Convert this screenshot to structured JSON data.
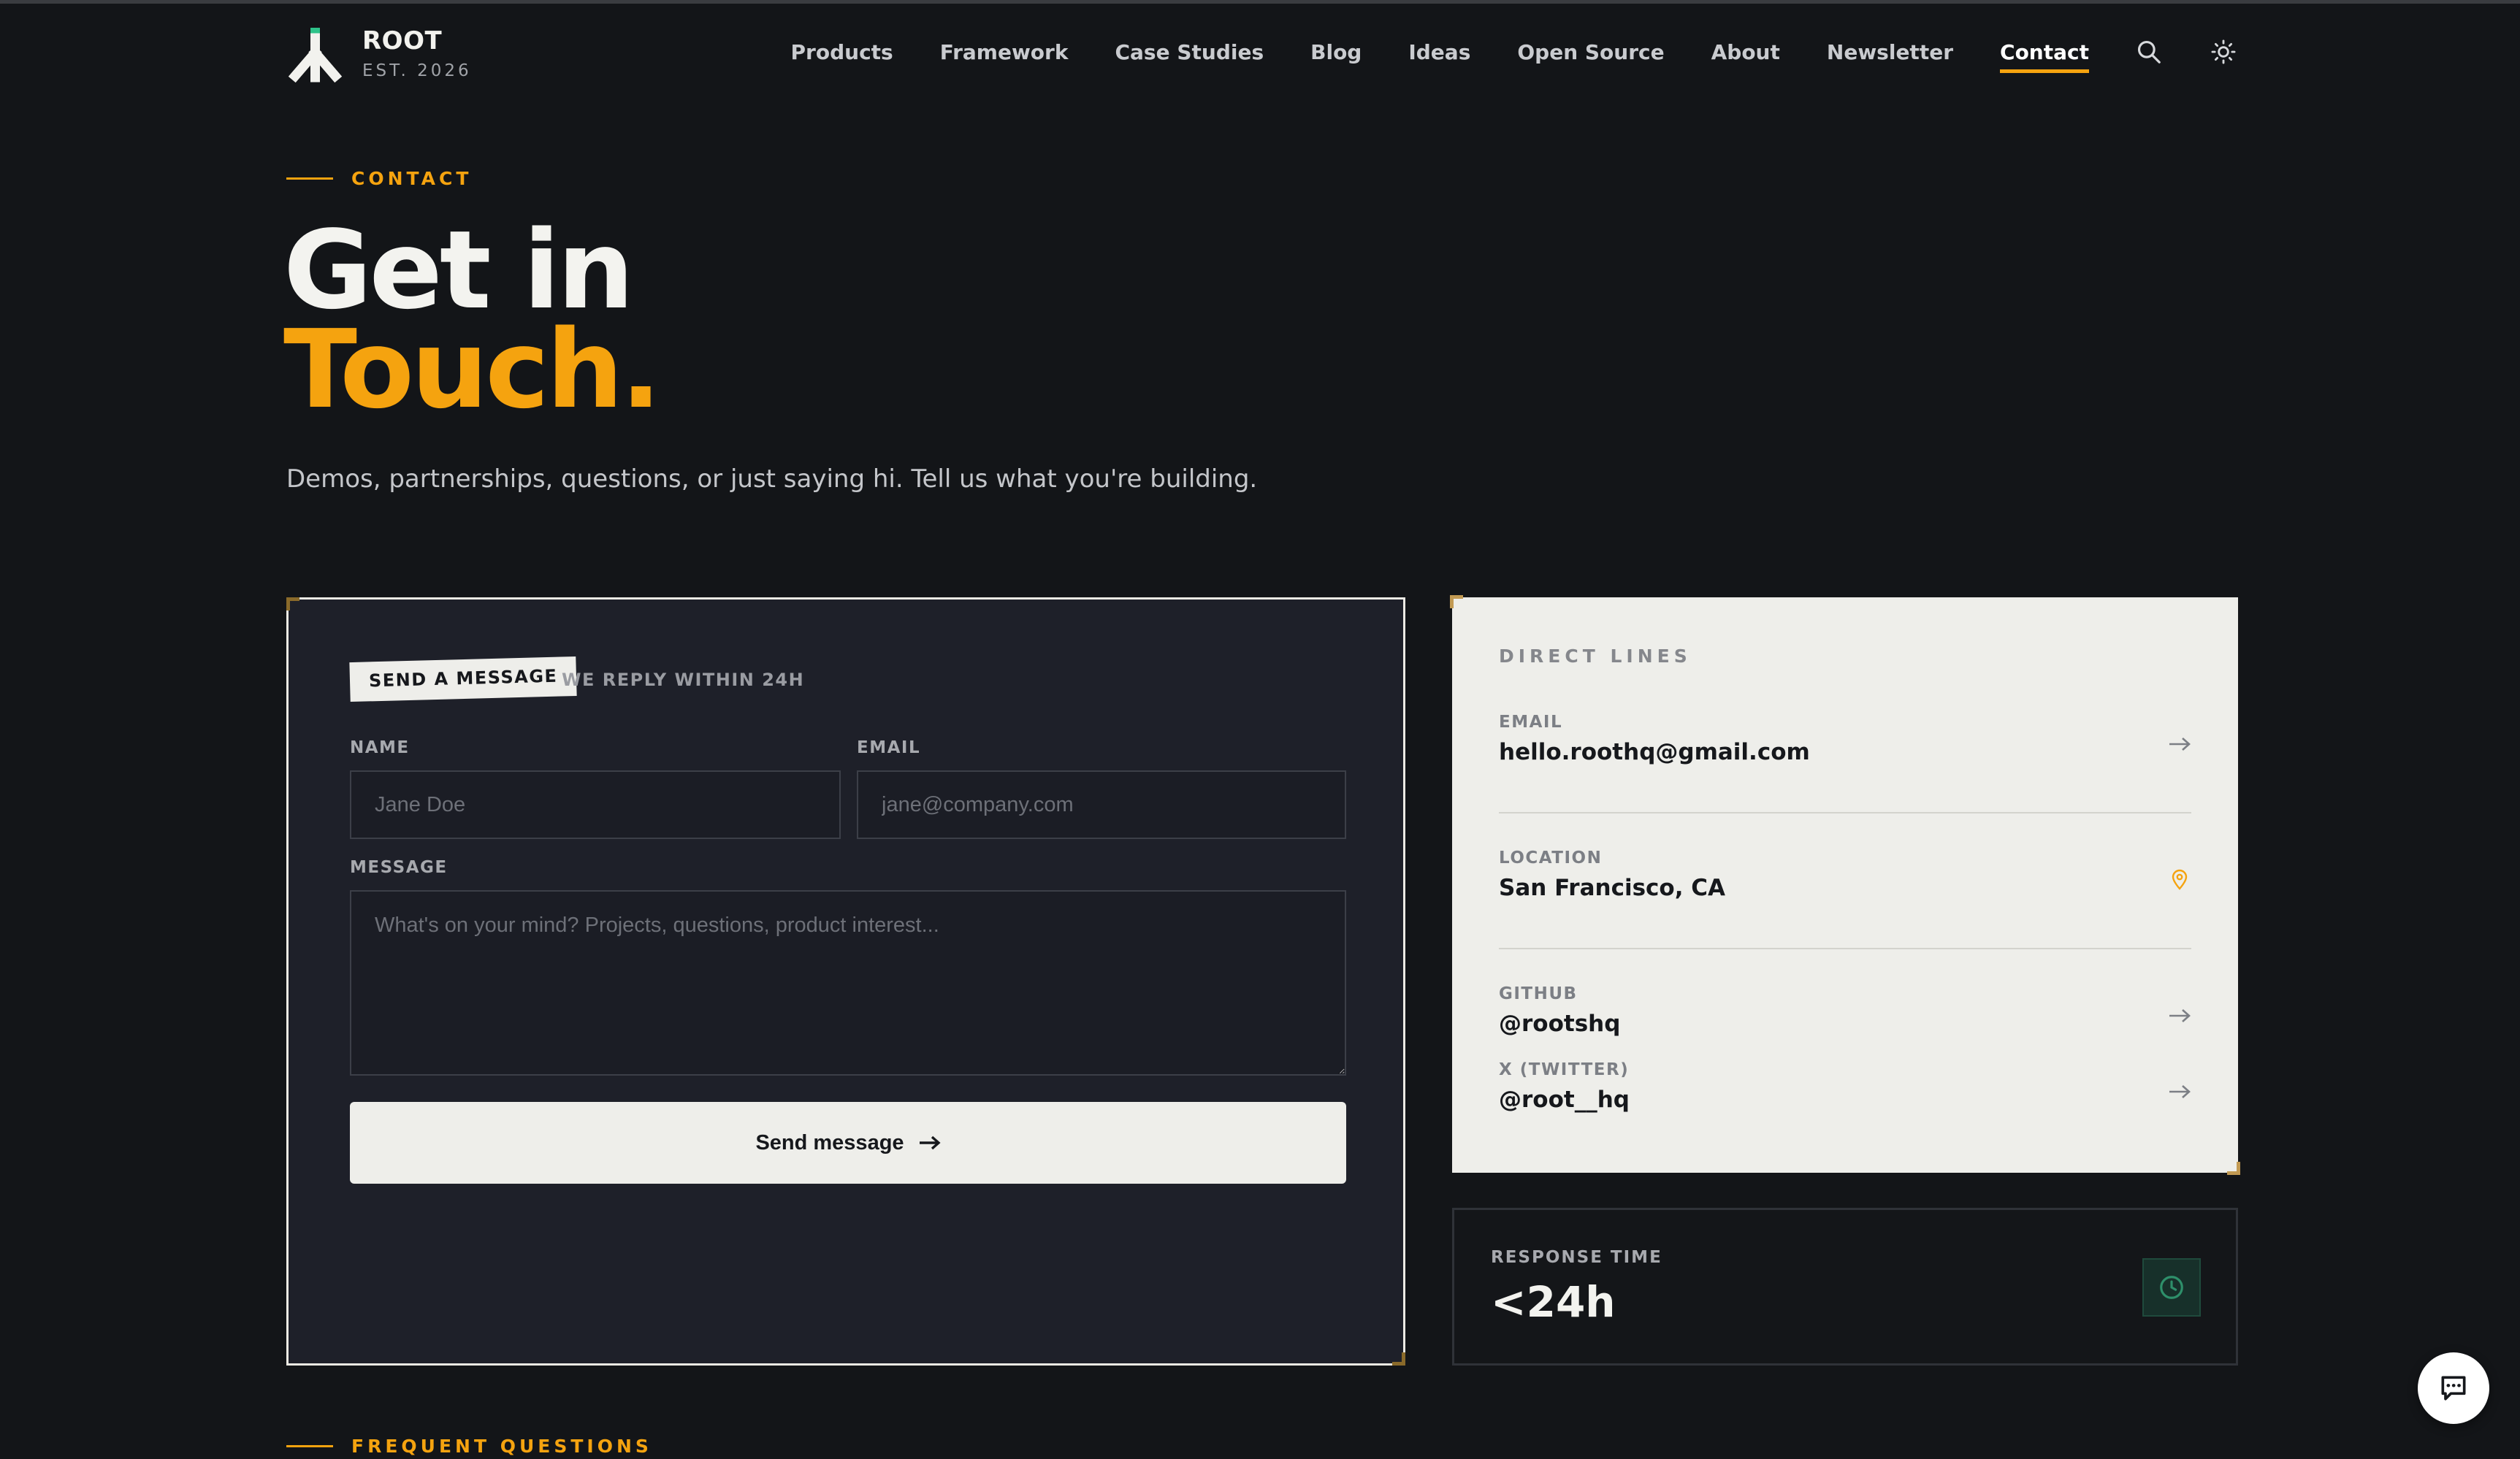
{
  "brand": {
    "name": "ROOT",
    "est": "EST. 2026"
  },
  "nav": {
    "items": [
      "Products",
      "Framework",
      "Case Studies",
      "Blog",
      "Ideas",
      "Open Source",
      "About",
      "Newsletter",
      "Contact"
    ],
    "active": "Contact",
    "icons": [
      "search-icon",
      "sun-icon"
    ]
  },
  "hero": {
    "eyebrow": "CONTACT",
    "title_line1": "Get in",
    "title_line2": "Touch.",
    "subtitle": "Demos, partnerships, questions, or just saying hi. Tell us what you're building."
  },
  "form": {
    "tag": "SEND A MESSAGE",
    "tag_note": "WE REPLY WITHIN 24H",
    "name_label": "NAME",
    "name_placeholder": "Jane Doe",
    "name_value": "",
    "email_label": "EMAIL",
    "email_placeholder": "jane@company.com",
    "email_value": "",
    "message_label": "MESSAGE",
    "message_placeholder": "What's on your mind? Projects, questions, product interest...",
    "message_value": "",
    "submit_label": "Send message"
  },
  "direct_lines": {
    "heading": "DIRECT LINES",
    "email_label": "EMAIL",
    "email_value": "hello.roothq@gmail.com",
    "location_label": "LOCATION",
    "location_value": "San Francisco, CA",
    "github_label": "GITHUB",
    "github_value": "@rootshq",
    "twitter_label": "X (TWITTER)",
    "twitter_value": "@root__hq"
  },
  "response": {
    "label": "RESPONSE TIME",
    "value": "<24h"
  },
  "faq": {
    "eyebrow": "FREQUENT QUESTIONS"
  },
  "colors": {
    "accent": "#f5a30f",
    "background": "#131518",
    "card_dark": "#1e2029",
    "card_light": "#eeeeea",
    "icon_green": "#2e8f6a"
  }
}
